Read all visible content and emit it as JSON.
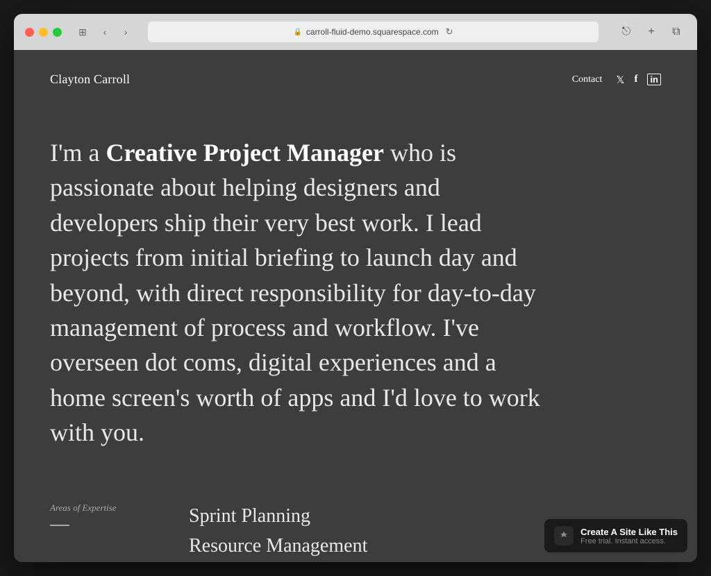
{
  "browser": {
    "url": "carroll-fluid-demo.squarespace.com",
    "reload_icon": "↻"
  },
  "header": {
    "site_title": "Clayton Carroll",
    "nav": {
      "contact_label": "Contact",
      "social": [
        {
          "name": "twitter",
          "icon": "𝕏",
          "display": "𝕏"
        },
        {
          "name": "facebook",
          "icon": "f"
        },
        {
          "name": "linkedin",
          "icon": "in"
        }
      ]
    }
  },
  "hero": {
    "intro_normal": "I'm a ",
    "intro_bold": "Creative Project Manager",
    "intro_rest": " who is passionate about helping designers and developers ship their very best work. I lead projects from initial briefing to launch day and beyond, with direct responsibility for day-to-day management of process and workflow. I've overseen dot coms, digital experiences and a home screen's worth of apps and I'd love to work with you."
  },
  "expertise": {
    "section_label": "Areas of Expertise",
    "items": [
      {
        "label": "Sprint Planning"
      },
      {
        "label": "Resource Management"
      }
    ]
  },
  "badge": {
    "main": "Create A Site Like This",
    "sub": "Free trial. Instant access."
  }
}
